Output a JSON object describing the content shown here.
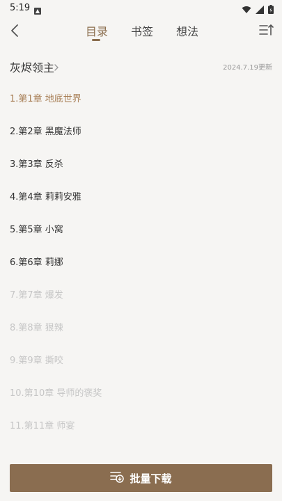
{
  "status_bar": {
    "time": "5:19"
  },
  "nav": {
    "tabs": [
      {
        "label": "目录",
        "active": true
      },
      {
        "label": "书签",
        "active": false
      },
      {
        "label": "想法",
        "active": false
      }
    ]
  },
  "book": {
    "title": "灰烬领主",
    "updated": "2024.7.19更新"
  },
  "chapters": [
    {
      "label": "1.第1章 地底世界",
      "state": "current"
    },
    {
      "label": "2.第2章 黑魔法师",
      "state": "normal"
    },
    {
      "label": "3.第3章 反杀",
      "state": "normal"
    },
    {
      "label": "4.第4章 莉莉安雅",
      "state": "normal"
    },
    {
      "label": "5.第5章 小窝",
      "state": "normal"
    },
    {
      "label": "6.第6章 莉娜",
      "state": "normal"
    },
    {
      "label": "7.第7章 爆发",
      "state": "locked"
    },
    {
      "label": "8.第8章 狠辣",
      "state": "locked"
    },
    {
      "label": "9.第9章 撕咬",
      "state": "locked"
    },
    {
      "label": "10.第10章 导师的褒奖",
      "state": "locked"
    },
    {
      "label": "11.第11章 师宴",
      "state": "locked"
    }
  ],
  "batch_download": {
    "label": "批量下载"
  },
  "colors": {
    "accent": "#8a6d4d",
    "current": "#a67c52",
    "locked": "#c6c6c6",
    "button": "#8a6d50"
  }
}
